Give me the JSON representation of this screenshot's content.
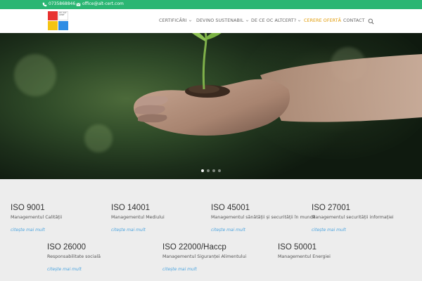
{
  "topbar": {
    "phone": "0735868846",
    "email": "office@alt-cert.com",
    "background": "#2bb673"
  },
  "header": {
    "logo_text": "OC ALT CERT",
    "logo_colors": [
      "#e8322f",
      "#ffffff",
      "#f4c414",
      "#2f8de4"
    ],
    "nav": [
      {
        "label": "CERTIFICĂRI",
        "has_dropdown": true
      },
      {
        "label": "DEVINO SUSTENABIL",
        "has_dropdown": true
      },
      {
        "label": "DE CE OC ALTCERT?",
        "has_dropdown": true
      },
      {
        "label": "CERERE OFERTĂ",
        "has_dropdown": false,
        "highlight": true
      },
      {
        "label": "CONTACT",
        "has_dropdown": false
      }
    ],
    "search_icon": "search-icon"
  },
  "hero": {
    "slides_total": 4,
    "active_slide": 1
  },
  "services": {
    "row1": [
      {
        "title": "ISO 9001",
        "desc": "Managementul Calității",
        "more": "citește mai mult"
      },
      {
        "title": "ISO 14001",
        "desc": "Managementul Mediului",
        "more": "citește mai mult"
      },
      {
        "title": "ISO 45001",
        "desc": "Managementul sănătății și securității în muncă",
        "more": "citește mai mult"
      },
      {
        "title": "ISO 27001",
        "desc": "Managementul securității informației",
        "more": "citește mai mult"
      }
    ],
    "row2": [
      {
        "title": "ISO 26000",
        "desc": "Responsabilitate socială",
        "more": "citește mai mult"
      },
      {
        "title": "ISO 22000/Haccp",
        "desc": "Managementul Siguranței Alimentului",
        "more": "citește mai mult"
      },
      {
        "title": "ISO 50001",
        "desc": "Managementul Energiei",
        "more": ""
      }
    ]
  },
  "colors": {
    "accent": "#e09900",
    "link": "#4aa3df",
    "nav_text": "#666666"
  }
}
